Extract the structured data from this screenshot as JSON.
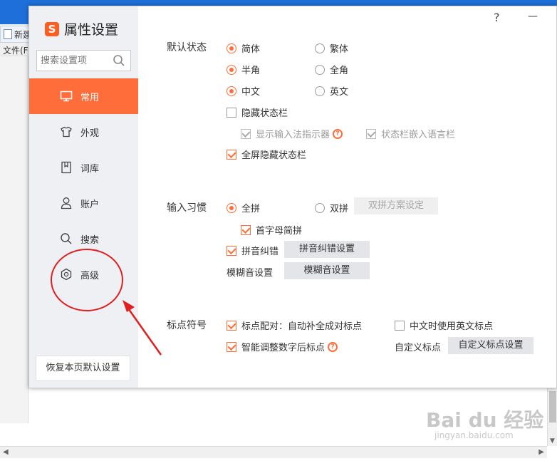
{
  "background_app": {
    "tab_label": "新建",
    "menu_label": "文件(F"
  },
  "dialog": {
    "title": "属性设置",
    "logo_letter": "S",
    "brand_color": "#ff6d3b",
    "window_controls": {
      "help": "?",
      "minimize": "—"
    },
    "search": {
      "placeholder": "搜索设置项"
    },
    "nav": [
      {
        "label": "常用",
        "icon": "monitor-icon",
        "active": true
      },
      {
        "label": "外观",
        "icon": "shirt-icon",
        "active": false
      },
      {
        "label": "词库",
        "icon": "book-icon",
        "active": false
      },
      {
        "label": "账户",
        "icon": "user-icon",
        "active": false
      },
      {
        "label": "搜索",
        "icon": "search-icon",
        "active": false
      },
      {
        "label": "高级",
        "icon": "gear-icon",
        "active": false
      }
    ],
    "restore_button": "恢复本页默认设置"
  },
  "default_state": {
    "label": "默认状态",
    "simplified": {
      "label": "简体",
      "selected": true
    },
    "traditional": {
      "label": "繁体",
      "selected": false
    },
    "half_width": {
      "label": "半角",
      "selected": true
    },
    "full_width": {
      "label": "全角",
      "selected": false
    },
    "chinese": {
      "label": "中文",
      "selected": true
    },
    "english": {
      "label": "英文",
      "selected": false
    },
    "hide_status_bar": {
      "label": "隐藏状态栏",
      "checked": false
    },
    "show_ime_indicator": {
      "label": "显示输入法指示器",
      "checked": true,
      "disabled": true
    },
    "embed_lang_bar": {
      "label": "状态栏嵌入语言栏",
      "checked": true,
      "disabled": true
    },
    "fullscreen_hide": {
      "label": "全屏隐藏状态栏",
      "checked": true
    }
  },
  "input_habit": {
    "label": "输入习惯",
    "full_pinyin": {
      "label": "全拼",
      "selected": true
    },
    "double_pinyin": {
      "label": "双拼",
      "selected": false
    },
    "double_pinyin_button": "双拼方案设定",
    "initial_abbrev": {
      "label": "首字母简拼",
      "checked": true
    },
    "pinyin_correction": {
      "label": "拼音纠错",
      "checked": true
    },
    "pinyin_correction_button": "拼音纠错设置",
    "fuzzy_label": "模糊音设置",
    "fuzzy_button": "模糊音设置"
  },
  "punctuation": {
    "label": "标点符号",
    "auto_pair": {
      "label": "标点配对：自动补全成对标点",
      "checked": true
    },
    "english_punct": {
      "label": "中文时使用英文标点",
      "checked": false
    },
    "smart_adjust": {
      "label": "智能调整数字后标点",
      "checked": true
    },
    "custom_label": "自定义标点",
    "custom_button": "自定义标点设置"
  },
  "annotation": {
    "color": "#e02020"
  },
  "watermark": {
    "text": "Bai du 经验",
    "url": "jingyan.baidu.com"
  }
}
